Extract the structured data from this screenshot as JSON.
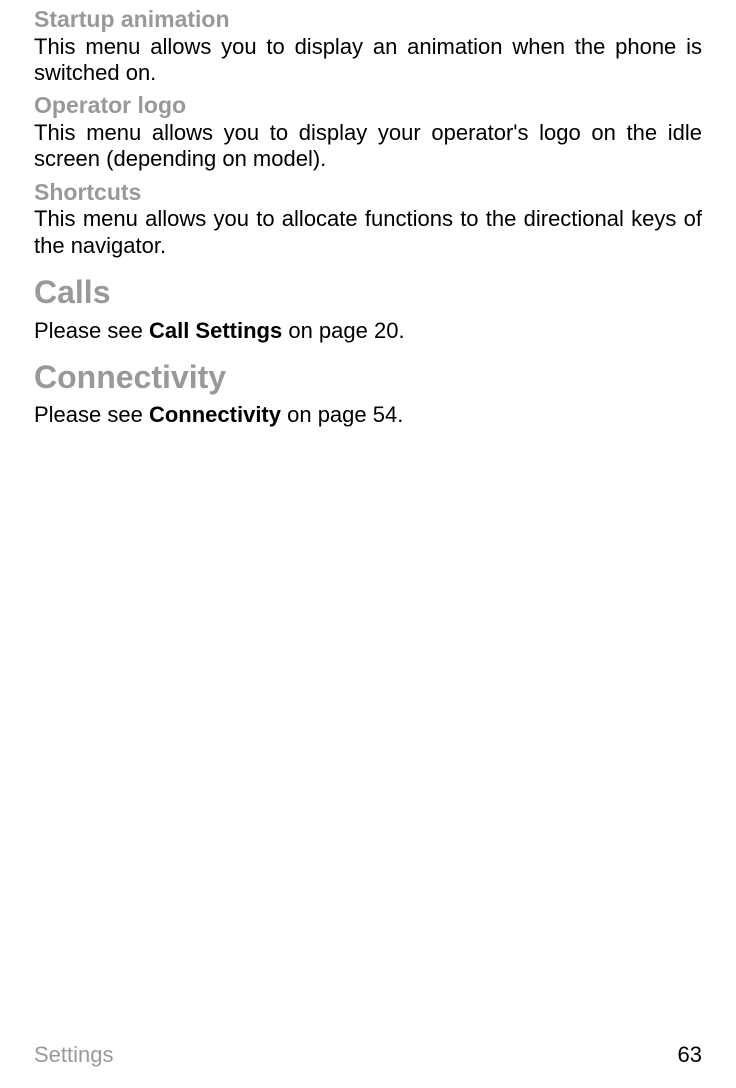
{
  "sections": {
    "startup": {
      "heading": "Startup animation",
      "body": "This menu allows you to display an animation when the phone is switched on."
    },
    "operator": {
      "heading": "Operator logo",
      "body": "This menu allows you to display your operator's logo on the idle screen (depending on model)."
    },
    "shortcuts": {
      "heading": "Shortcuts",
      "body": "This menu allows you to allocate functions to the directional keys of the navigator."
    },
    "calls": {
      "heading": "Calls",
      "body_prefix": "Please see ",
      "body_bold": "Call Settings",
      "body_suffix": " on page 20."
    },
    "connectivity": {
      "heading": "Connectivity",
      "body_prefix": "Please see ",
      "body_bold": "Connectivity",
      "body_suffix": " on page 54."
    }
  },
  "footer": {
    "left": "Settings",
    "page": "63"
  }
}
